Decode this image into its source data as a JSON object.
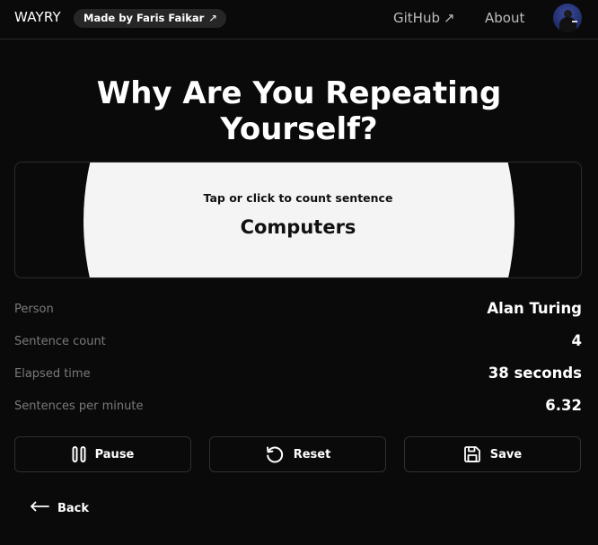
{
  "header": {
    "brand": "WAYRY",
    "made_by": "Made by Faris Faikar",
    "made_by_arrow": "↗",
    "nav": {
      "github": "GitHub",
      "github_arrow": "↗",
      "about": "About"
    }
  },
  "title": "Why Are You Repeating Yourself?",
  "counter": {
    "hint": "Tap or click to count sentence",
    "sentence": "Computers"
  },
  "stats": [
    {
      "label": "Person",
      "value": "Alan Turing"
    },
    {
      "label": "Sentence count",
      "value": "4"
    },
    {
      "label": "Elapsed time",
      "value": "38 seconds"
    },
    {
      "label": "Sentences per minute",
      "value": "6.32"
    }
  ],
  "actions": {
    "pause": "Pause",
    "reset": "Reset",
    "save": "Save"
  },
  "back": "Back",
  "icons": {
    "pause": "pause-icon",
    "reset": "reset-icon",
    "save": "save-icon",
    "back": "arrow-left-icon",
    "external": "external-link-arrow"
  },
  "colors": {
    "background": "#0a0a0a",
    "panel_fill": "#f4f4f4",
    "border": "#2c2c2c",
    "muted_text": "#7a7a7a"
  }
}
